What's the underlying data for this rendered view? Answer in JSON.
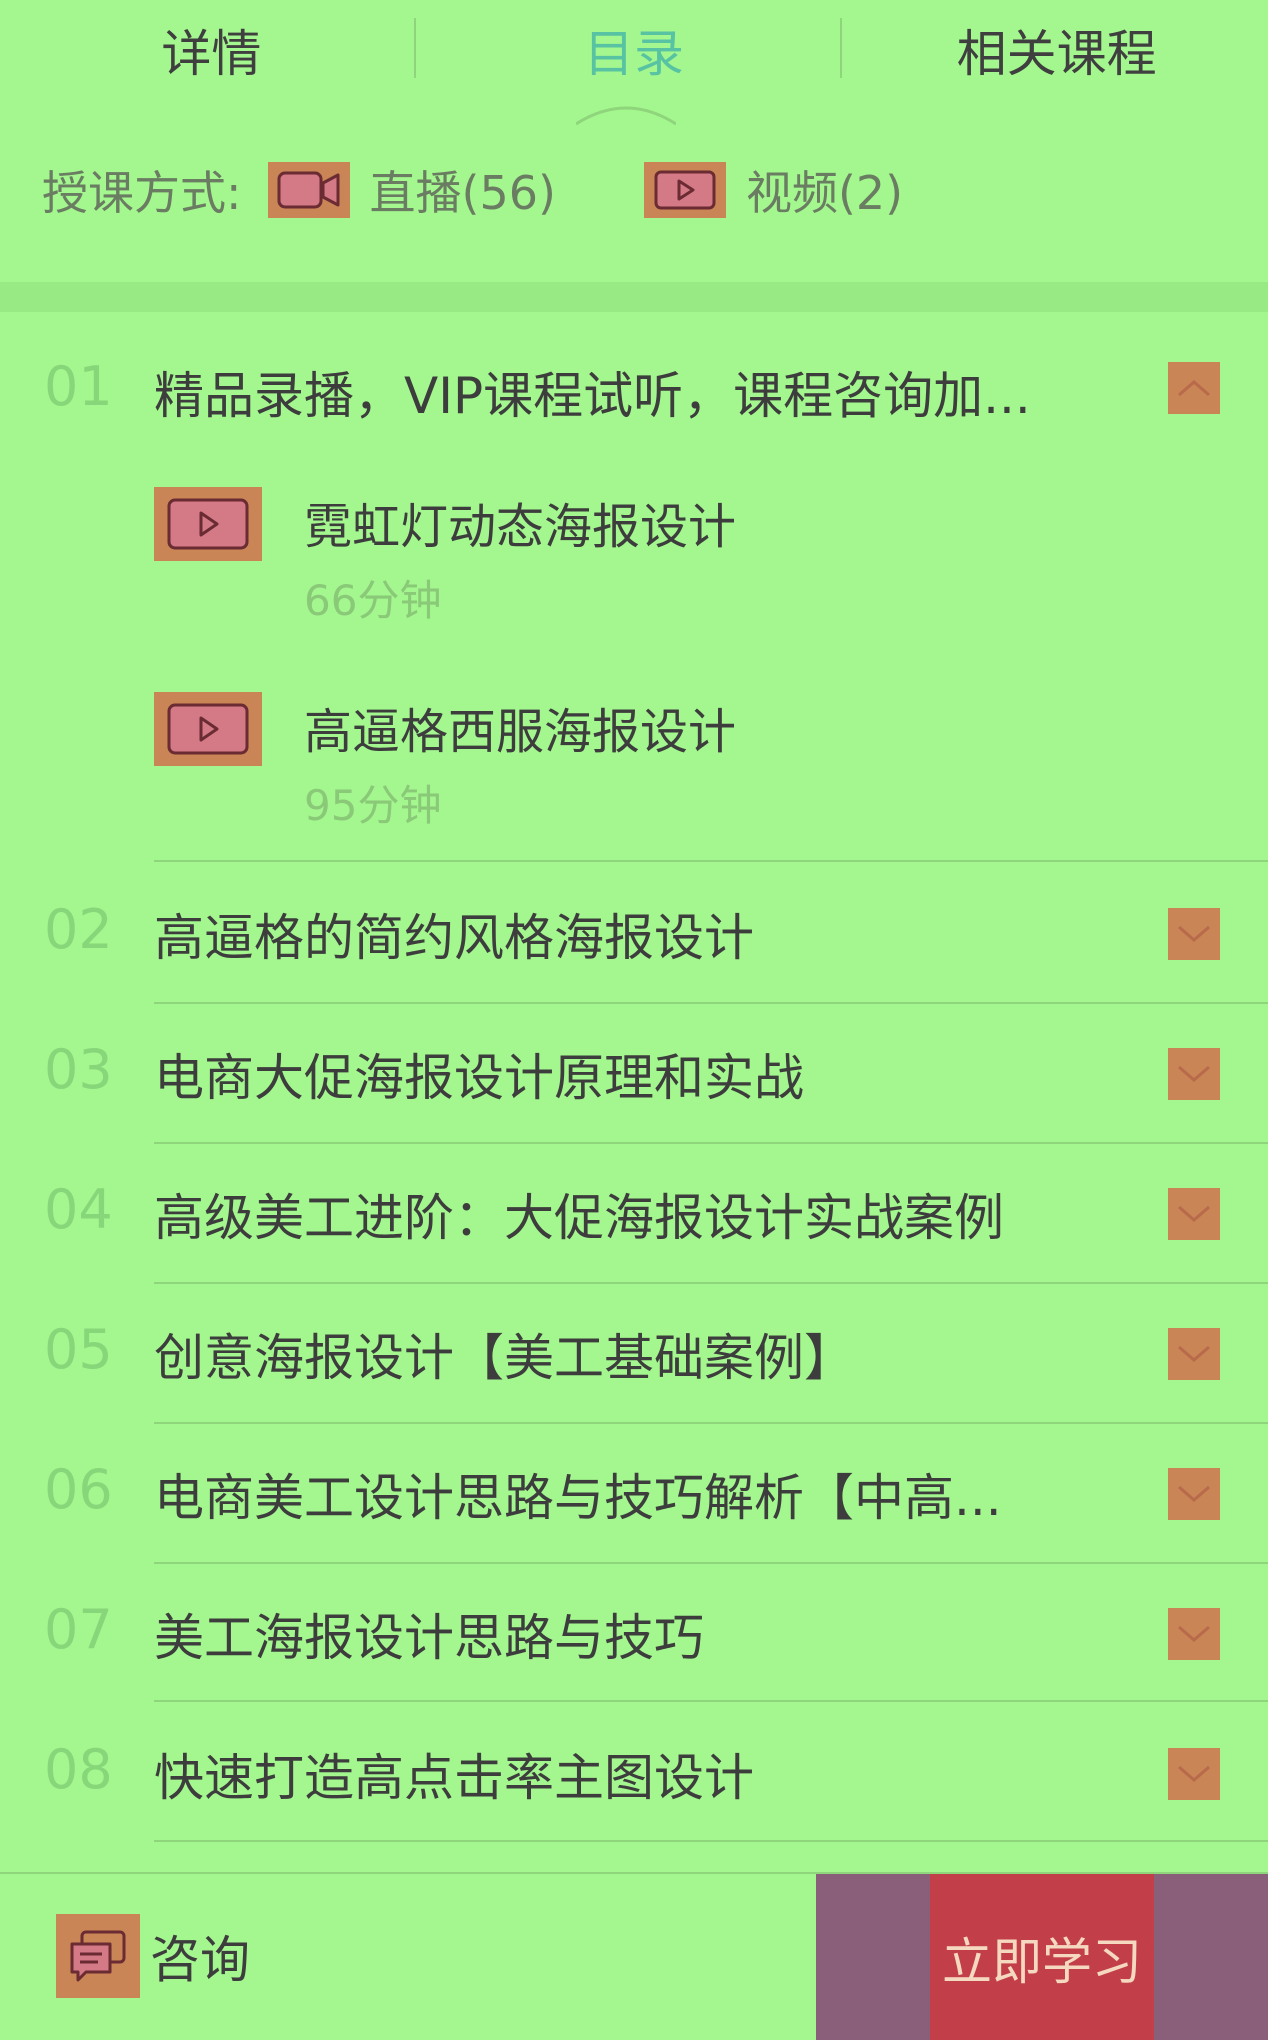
{
  "tabs": [
    {
      "label": "详情",
      "active": false
    },
    {
      "label": "目录",
      "active": true
    },
    {
      "label": "相关课程",
      "active": false
    }
  ],
  "teaching_mode": {
    "label": "授课方式:",
    "live": {
      "icon": "video-camera-icon",
      "text": "直播(56)"
    },
    "video": {
      "icon": "play-icon",
      "text": "视频(2)"
    }
  },
  "chapters": [
    {
      "num": "01",
      "title": "精品录播，VIP课程试听，课程咨询加...",
      "expanded": true,
      "toggle_icon": "chevron-up-icon",
      "lessons": [
        {
          "icon": "play-icon",
          "title": "霓虹灯动态海报设计",
          "duration": "66分钟"
        },
        {
          "icon": "play-icon",
          "title": "高逼格西服海报设计",
          "duration": "95分钟"
        }
      ]
    },
    {
      "num": "02",
      "title": "高逼格的简约风格海报设计",
      "expanded": false,
      "toggle_icon": "chevron-down-icon"
    },
    {
      "num": "03",
      "title": "电商大促海报设计原理和实战",
      "expanded": false,
      "toggle_icon": "chevron-down-icon"
    },
    {
      "num": "04",
      "title": "高级美工进阶：大促海报设计实战案例",
      "expanded": false,
      "toggle_icon": "chevron-down-icon"
    },
    {
      "num": "05",
      "title": "创意海报设计【美工基础案例】",
      "expanded": false,
      "toggle_icon": "chevron-down-icon"
    },
    {
      "num": "06",
      "title": "电商美工设计思路与技巧解析【中高...",
      "expanded": false,
      "toggle_icon": "chevron-down-icon"
    },
    {
      "num": "07",
      "title": "美工海报设计思路与技巧",
      "expanded": false,
      "toggle_icon": "chevron-down-icon"
    },
    {
      "num": "08",
      "title": "快速打造高点击率主图设计",
      "expanded": false,
      "toggle_icon": "chevron-down-icon"
    }
  ],
  "bottom_bar": {
    "consult": {
      "icon": "chat-icon",
      "label": "咨询"
    },
    "study_button": "立即学习"
  },
  "colors": {
    "background": "#a3f78e",
    "active_tab": "#58c3a2",
    "icon_bg": "#c98556",
    "study_button": "#c23f4a",
    "study_area": "#8a5f7a"
  }
}
